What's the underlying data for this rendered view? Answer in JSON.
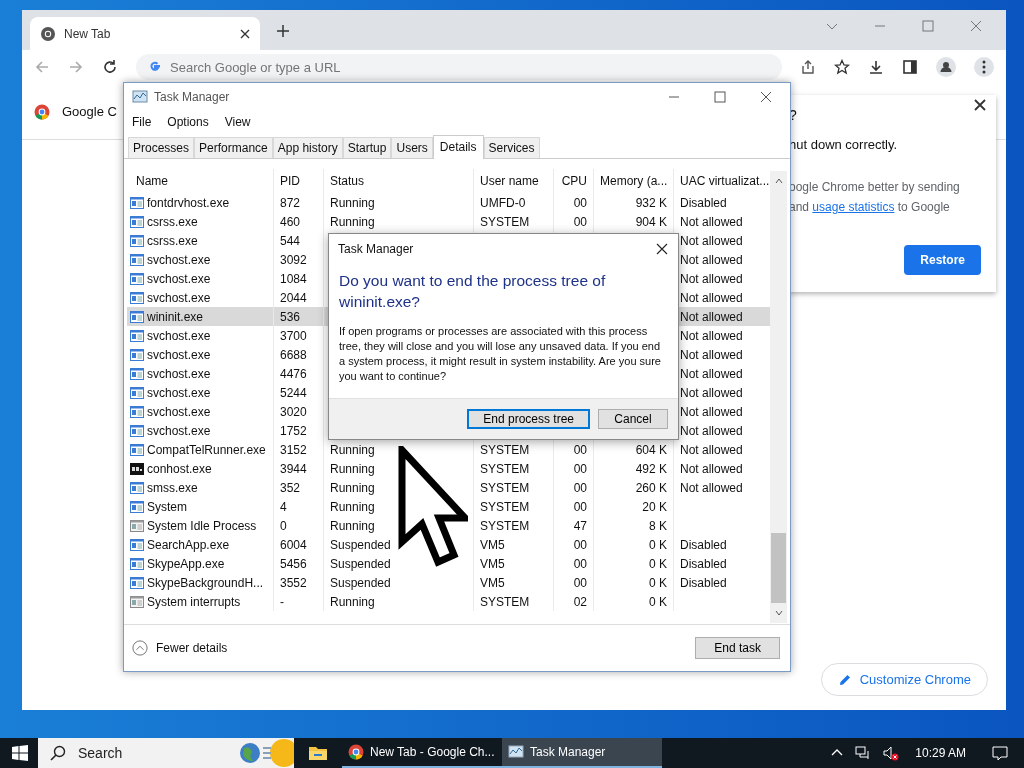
{
  "chrome": {
    "tabs": [
      {
        "title": "New Tab",
        "selected": true
      }
    ],
    "omnibox": {
      "placeholder": "Search Google or type a URL"
    },
    "bookmark": "Google C",
    "restore_bubble": {
      "title_end": "?",
      "message_end": "hut down correctly.",
      "consent_line_1": "oogle Chrome better by sending",
      "consent_and": "and",
      "consent_link": "usage statistics",
      "consent_end": "to Google",
      "button": "Restore"
    },
    "customize_button": "Customize Chrome"
  },
  "task_manager": {
    "title": "Task Manager",
    "menu": [
      "File",
      "Options",
      "View"
    ],
    "tabs": [
      {
        "label": "Processes",
        "selected": false
      },
      {
        "label": "Performance",
        "selected": false
      },
      {
        "label": "App history",
        "selected": false
      },
      {
        "label": "Startup",
        "selected": false
      },
      {
        "label": "Users",
        "selected": false
      },
      {
        "label": "Details",
        "selected": true
      },
      {
        "label": "Services",
        "selected": false
      }
    ],
    "columns": [
      "Name",
      "PID",
      "Status",
      "User name",
      "CPU",
      "Memory (a...",
      "UAC virtualizat..."
    ],
    "rows": [
      {
        "kind": "app",
        "name": "fontdrvhost.exe",
        "pid": "872",
        "status": "Running",
        "user": "UMFD-0",
        "cpu": "00",
        "memory": "932 K",
        "uac": "Disabled",
        "selected": false
      },
      {
        "kind": "app",
        "name": "csrss.exe",
        "pid": "460",
        "status": "Running",
        "user": "SYSTEM",
        "cpu": "00",
        "memory": "904 K",
        "uac": "Not allowed",
        "selected": false
      },
      {
        "kind": "app",
        "name": "csrss.exe",
        "pid": "544",
        "uac": "Not allowed",
        "selected": false
      },
      {
        "kind": "app",
        "name": "svchost.exe",
        "pid": "3092",
        "uac": "Not allowed",
        "selected": false
      },
      {
        "kind": "app",
        "name": "svchost.exe",
        "pid": "1084",
        "uac": "Not allowed",
        "selected": false
      },
      {
        "kind": "app",
        "name": "svchost.exe",
        "pid": "2044",
        "uac": "Not allowed",
        "selected": false
      },
      {
        "kind": "app",
        "name": "wininit.exe",
        "pid": "536",
        "uac": "Not allowed",
        "selected": true
      },
      {
        "kind": "app",
        "name": "svchost.exe",
        "pid": "3700",
        "uac": "Not allowed",
        "selected": false
      },
      {
        "kind": "app",
        "name": "svchost.exe",
        "pid": "6688",
        "uac": "Not allowed",
        "selected": false
      },
      {
        "kind": "app",
        "name": "svchost.exe",
        "pid": "4476",
        "uac": "Not allowed",
        "selected": false
      },
      {
        "kind": "app",
        "name": "svchost.exe",
        "pid": "5244",
        "uac": "Not allowed",
        "selected": false
      },
      {
        "kind": "app",
        "name": "svchost.exe",
        "pid": "3020",
        "uac": "Not allowed",
        "selected": false
      },
      {
        "kind": "app",
        "name": "svchost.exe",
        "pid": "1752",
        "uac": "Not allowed",
        "selected": false
      },
      {
        "kind": "app",
        "name": "CompatTelRunner.exe",
        "pid": "3152",
        "status": "Running",
        "user": "SYSTEM",
        "cpu": "00",
        "memory": "604 K",
        "uac": "Not allowed",
        "selected": false
      },
      {
        "kind": "console",
        "name": "conhost.exe",
        "pid": "3944",
        "status": "Running",
        "user": "SYSTEM",
        "cpu": "00",
        "memory": "492 K",
        "uac": "Not allowed",
        "selected": false
      },
      {
        "kind": "app",
        "name": "smss.exe",
        "pid": "352",
        "status": "Running",
        "user": "SYSTEM",
        "cpu": "00",
        "memory": "260 K",
        "uac": "Not allowed",
        "selected": false
      },
      {
        "kind": "app",
        "name": "System",
        "pid": "4",
        "status": "Running",
        "user": "SYSTEM",
        "cpu": "00",
        "memory": "20 K",
        "selected": false
      },
      {
        "kind": "system",
        "name": "System Idle Process",
        "pid": "0",
        "status": "Running",
        "user": "SYSTEM",
        "cpu": "47",
        "memory": "8 K",
        "selected": false
      },
      {
        "kind": "app",
        "name": "SearchApp.exe",
        "pid": "6004",
        "status": "Suspended",
        "user": "VM5",
        "cpu": "00",
        "memory": "0 K",
        "uac": "Disabled",
        "selected": false
      },
      {
        "kind": "app",
        "name": "SkypeApp.exe",
        "pid": "5456",
        "status": "Suspended",
        "user": "VM5",
        "cpu": "00",
        "memory": "0 K",
        "uac": "Disabled",
        "selected": false
      },
      {
        "kind": "app",
        "name": "SkypeBackgroundH...",
        "pid": "3552",
        "status": "Suspended",
        "user": "VM5",
        "cpu": "00",
        "memory": "0 K",
        "uac": "Disabled",
        "selected": false
      },
      {
        "kind": "system",
        "name": "System interrupts",
        "pid": "-",
        "status": "Running",
        "user": "SYSTEM",
        "cpu": "02",
        "memory": "0 K",
        "selected": false
      }
    ],
    "fewer_details": "Fewer details",
    "end_task": "End task"
  },
  "dialog": {
    "title": "Task Manager",
    "heading": "Do you want to end the process tree of wininit.exe?",
    "body": "If open programs or processes are associated with this process tree, they will close and you will lose any unsaved data. If you end a system process, it might result in system instability. Are you sure you want to continue?",
    "buttons": [
      {
        "label": "End process tree",
        "default": true
      },
      {
        "label": "Cancel",
        "default": false
      }
    ]
  },
  "taskbar": {
    "search": "Search",
    "apps": [
      {
        "kind": "chrome",
        "label": "New Tab - Google Ch...",
        "selected": false
      },
      {
        "kind": "taskmgr",
        "label": "Task Manager",
        "selected": true
      }
    ],
    "time": "10:29 AM"
  }
}
